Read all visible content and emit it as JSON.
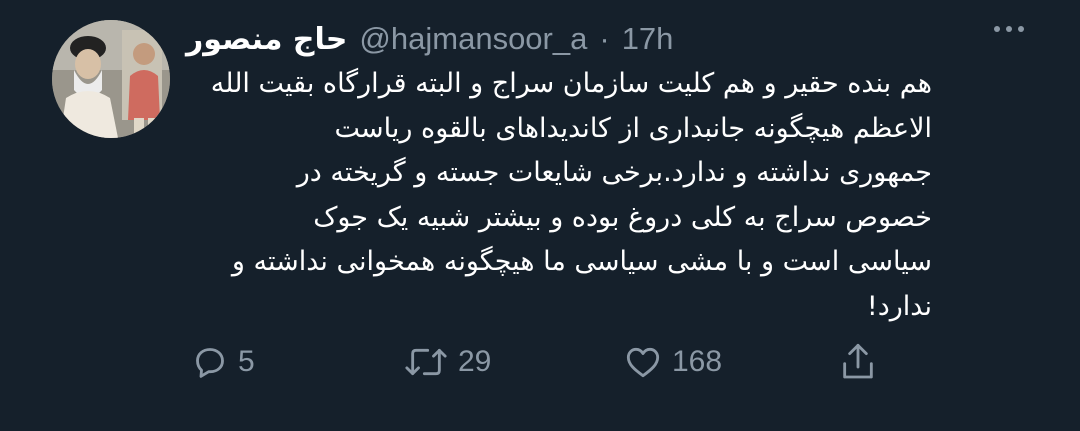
{
  "tweet": {
    "author": {
      "display_name": "حاج منصور",
      "handle": "@hajmansoor_a",
      "separator": "·",
      "time": "17h"
    },
    "text_lines": [
      "هم بنده حقیر و هم کلیت سازمان سراج و البته قرارگاه بقیت الله",
      "الاعظم  هیچگونه جانبداری از کاندیداهای بالقوه ریاست",
      "جمهوری نداشته و ندارد.برخی شایعات جسته و گریخته در",
      "خصوص سراج  به کلی دروغ بوده و بیشتر شبیه یک جوک",
      "سیاسی است و با مشی سیاسی ما هیچگونه همخوانی نداشته و",
      "ندارد!"
    ],
    "actions": {
      "reply": {
        "icon": "reply-icon",
        "count": "5"
      },
      "retweet": {
        "icon": "retweet-icon",
        "count": "29"
      },
      "like": {
        "icon": "heart-icon",
        "count": "168"
      },
      "share": {
        "icon": "share-icon"
      }
    },
    "more_icon": "more-options-icon"
  },
  "colors": {
    "background": "#15202b",
    "text": "#ffffff",
    "secondary": "#8b98a5"
  }
}
